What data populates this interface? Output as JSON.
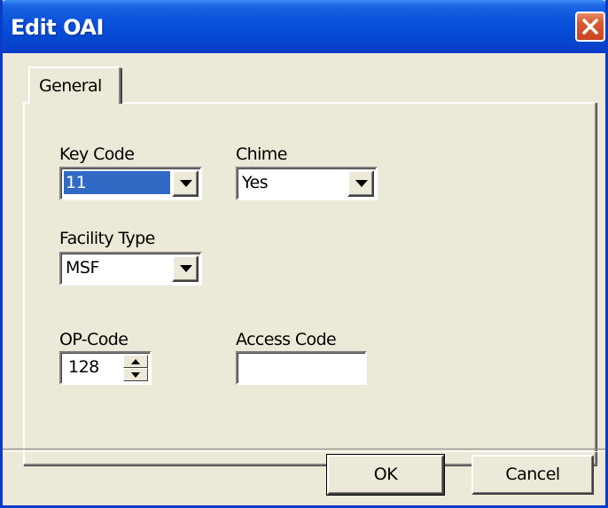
{
  "window": {
    "title": "Edit OAI"
  },
  "tabs": [
    {
      "label": "General",
      "selected": true
    }
  ],
  "fields": {
    "key_code": {
      "label": "Key Code",
      "value": "11"
    },
    "chime": {
      "label": "Chime",
      "value": "Yes"
    },
    "facility_type": {
      "label": "Facility Type",
      "value": "MSF"
    },
    "op_code": {
      "label": "OP-Code",
      "value": "128"
    },
    "access_code": {
      "label": "Access Code",
      "value": ""
    }
  },
  "buttons": {
    "ok": "OK",
    "cancel": "Cancel"
  },
  "colors": {
    "title_bar": "#0a52dc",
    "selection": "#316ac5",
    "close_button": "#d85a32"
  },
  "icons": {
    "close": "close-icon",
    "dropdown": "chevron-down-icon",
    "spin_up": "arrow-up-icon",
    "spin_down": "arrow-down-icon"
  }
}
